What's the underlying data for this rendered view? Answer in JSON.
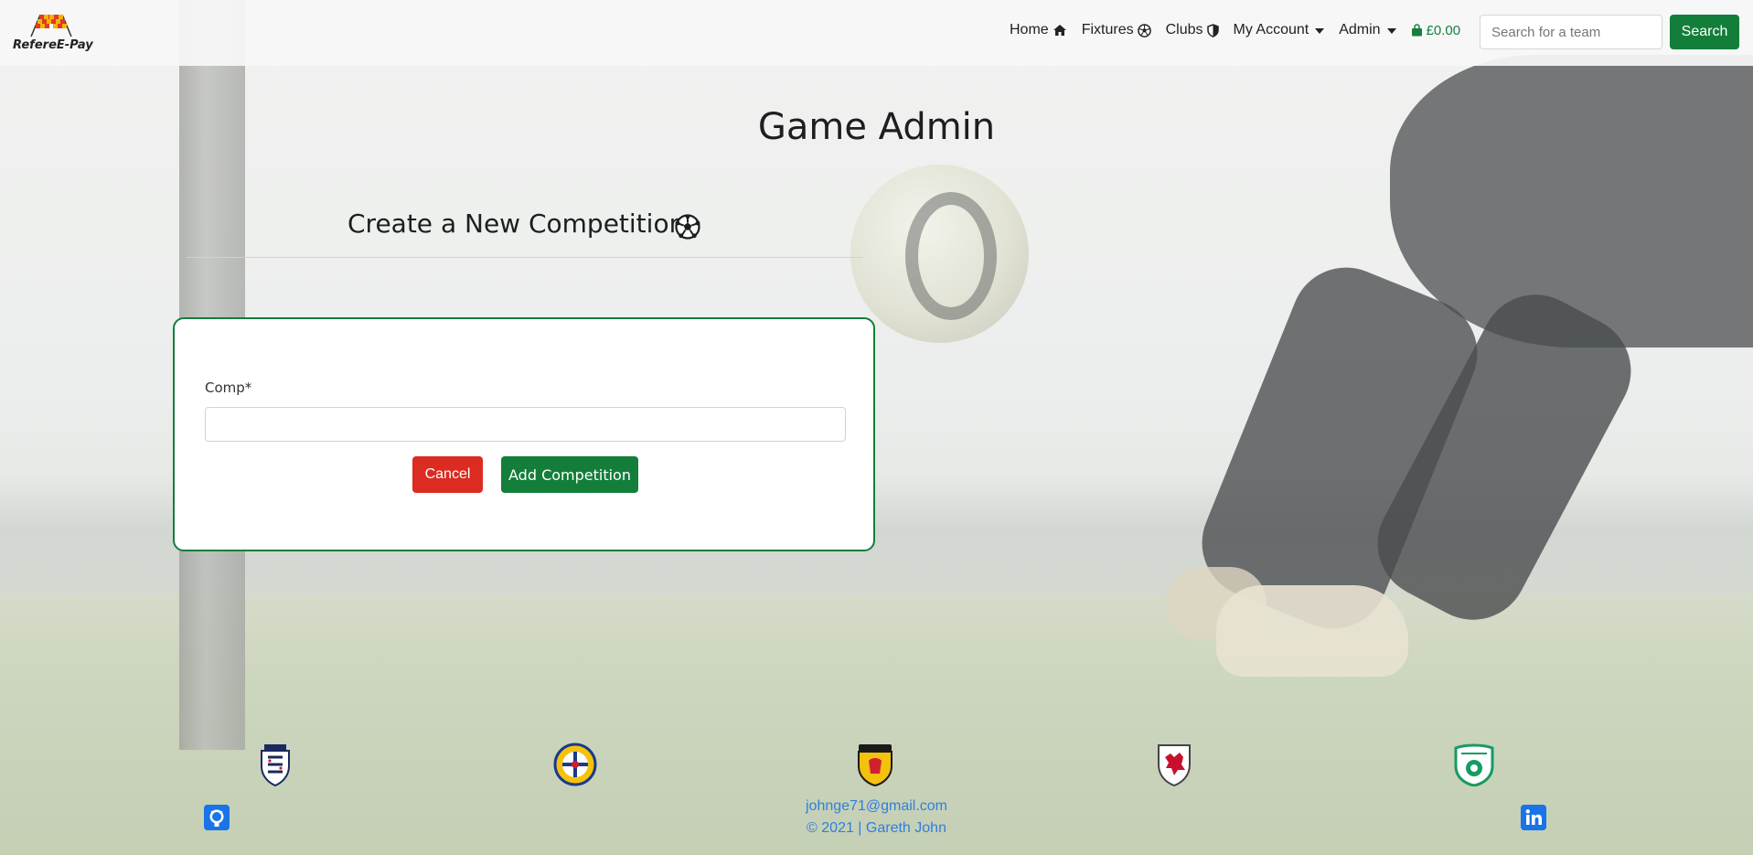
{
  "brand": {
    "name": "RefereE-Pay"
  },
  "nav": {
    "items": [
      {
        "label": "Home",
        "icon": "home-icon"
      },
      {
        "label": "Fixtures",
        "icon": "football-icon"
      },
      {
        "label": "Clubs",
        "icon": "shield-icon"
      },
      {
        "label": "My Account",
        "dropdown": true
      },
      {
        "label": "Admin",
        "dropdown": true
      }
    ],
    "basket": "£0.00",
    "search_placeholder": "Search for a team",
    "search_button": "Search"
  },
  "main": {
    "title": "Game Admin",
    "section_title": "Create a New Competition",
    "form": {
      "field_label": "Comp*",
      "field_value": "",
      "cancel_label": "Cancel",
      "submit_label": "Add Competition"
    }
  },
  "footer": {
    "crests": [
      "england-fa-crest",
      "northern-ireland-fa-crest",
      "scotland-fa-crest",
      "wales-fa-crest",
      "ireland-fai-crest"
    ],
    "email": "johnge71@gmail.com",
    "copyright": "© 2021 | Gareth John",
    "social": [
      "github-icon",
      "linkedin-icon"
    ]
  },
  "colors": {
    "brand_green": "#137e3a",
    "danger_red": "#dc2b20",
    "link_blue": "#2f7fe0"
  }
}
